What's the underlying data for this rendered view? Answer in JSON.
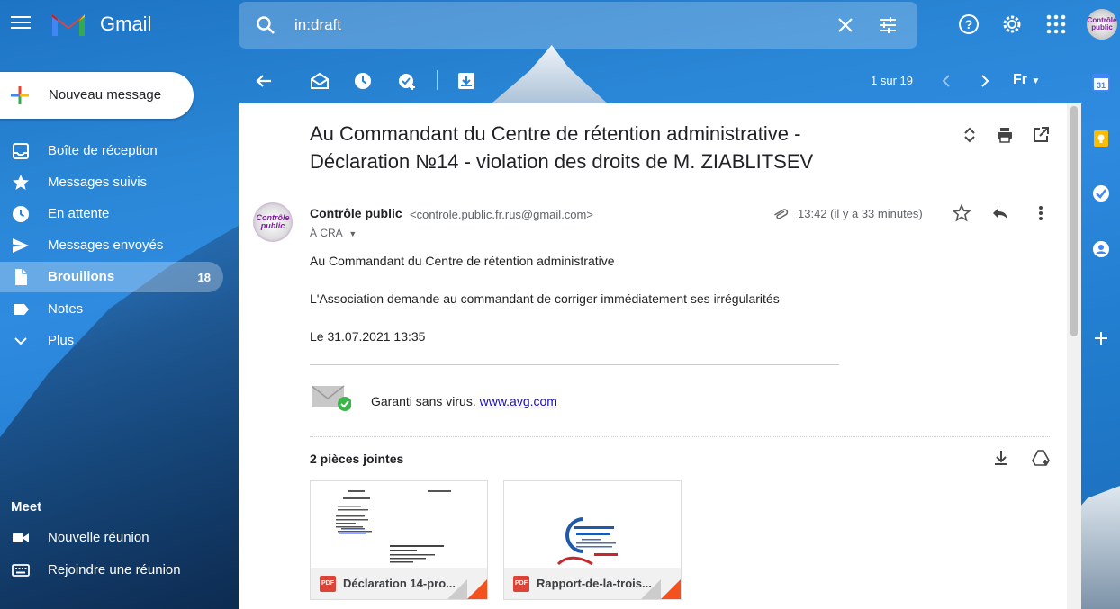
{
  "app": {
    "name": "Gmail"
  },
  "search": {
    "query": "in:draft"
  },
  "compose": {
    "label": "Nouveau message"
  },
  "nav": {
    "items": [
      {
        "label": "Boîte de réception",
        "count": ""
      },
      {
        "label": "Messages suivis",
        "count": ""
      },
      {
        "label": "En attente",
        "count": ""
      },
      {
        "label": "Messages envoyés",
        "count": ""
      },
      {
        "label": "Brouillons",
        "count": "18"
      },
      {
        "label": "Notes",
        "count": ""
      },
      {
        "label": "Plus",
        "count": ""
      }
    ]
  },
  "meet": {
    "title": "Meet",
    "items": [
      {
        "label": "Nouvelle réunion"
      },
      {
        "label": "Rejoindre une réunion"
      }
    ]
  },
  "toolbar": {
    "pager": "1 sur 19",
    "input_tools": "Fr"
  },
  "message": {
    "subject": "Au Commandant du Centre de rétention administrative - Déclaration №14 - violation des droits de M. ZIABLITSEV",
    "sender_name": "Contrôle public",
    "sender_email": "<controle.public.fr.rus@gmail.com>",
    "sender_avatar_text": "Contrôle public",
    "recipient": "À CRA",
    "time": "13:42 (il y a 33 minutes)",
    "body": [
      "Au Commandant du  Centre de rétention administrative",
      "L'Association demande au commandant de corriger immédiatement ses irrégularités",
      "Le 31.07.2021 13:35"
    ],
    "avg_text": "Garanti sans virus.",
    "avg_link": "www.avg.com"
  },
  "attachments": {
    "title": "2 pièces jointes",
    "files": [
      {
        "name": "Déclaration 14-pro...",
        "type": "PDF"
      },
      {
        "name": "Rapport-de-la-trois...",
        "type": "PDF"
      }
    ]
  },
  "account": {
    "avatar_text": "Contrôle public"
  },
  "colors": {
    "accent": "#1a73e8",
    "brouillons_bg": "rgba(255,255,255,0.28)",
    "pdf": "#db4437"
  }
}
